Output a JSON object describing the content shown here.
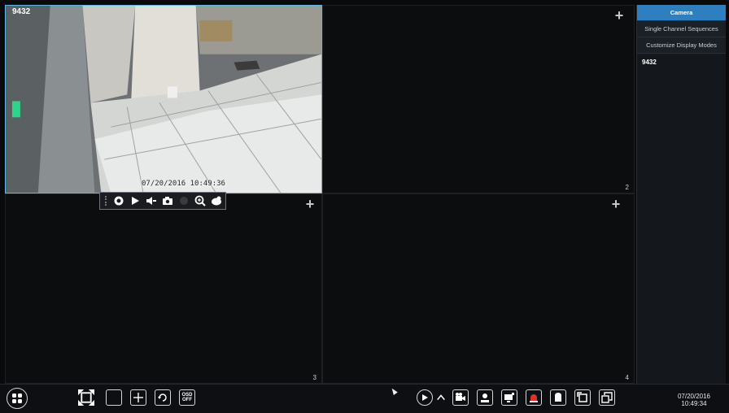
{
  "grid": {
    "tiles": [
      {
        "id": 1,
        "camera_name": "9432",
        "timestamp": "07/20/2016 10:49:36",
        "number": "",
        "selected": true
      },
      {
        "id": 2,
        "camera_name": "",
        "timestamp": "",
        "number": "2",
        "selected": false
      },
      {
        "id": 3,
        "camera_name": "",
        "timestamp": "",
        "number": "3",
        "selected": false
      },
      {
        "id": 4,
        "camera_name": "",
        "timestamp": "",
        "number": "4",
        "selected": false
      }
    ],
    "add_symbol": "+"
  },
  "channel_toolbar": {
    "buttons": [
      "record-icon",
      "play-icon",
      "audio-icon",
      "snapshot-icon",
      "spacer",
      "zoom-icon",
      "color-icon"
    ]
  },
  "sidebar": {
    "tabs": [
      {
        "label": "Camera",
        "active": true
      },
      {
        "label": "Single Channel Sequences",
        "active": false
      },
      {
        "label": "Customize Display Modes",
        "active": false
      }
    ],
    "cameras": [
      "9432"
    ]
  },
  "bottom_toolbar": {
    "osd_label_line1": "OSD",
    "osd_label_line2": "OFF",
    "clock_date": "07/20/2016",
    "clock_time": "10:49:34"
  },
  "colors": {
    "accent": "#2d7fc0",
    "selected_border": "#5ab9e6",
    "alarm_red": "#e0302a"
  }
}
